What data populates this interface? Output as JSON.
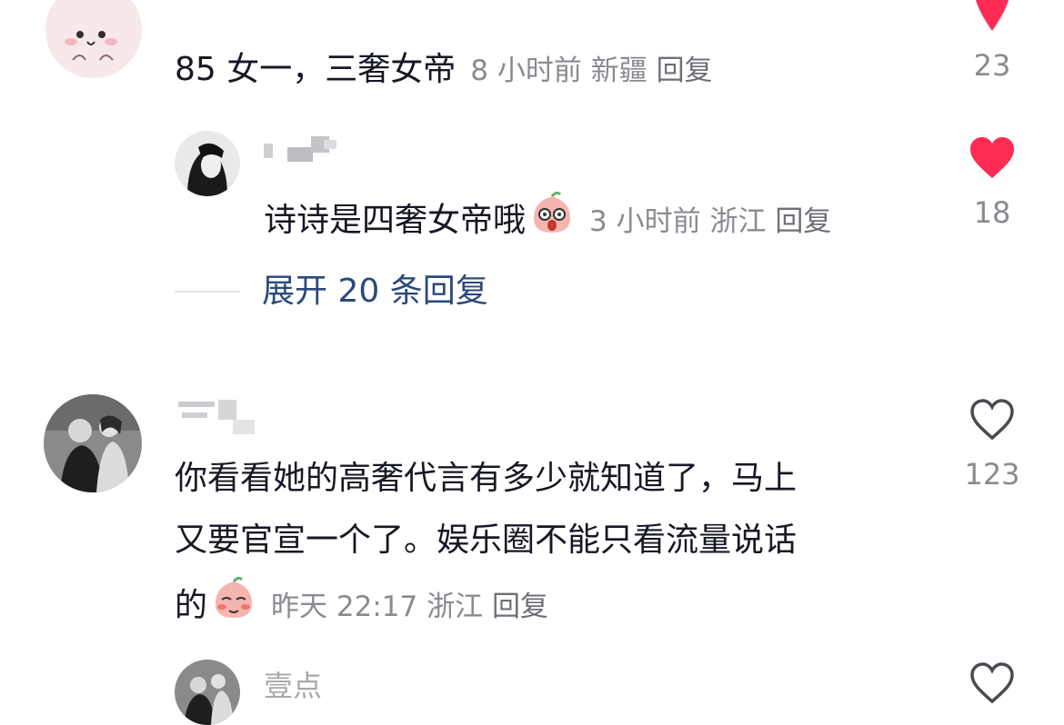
{
  "comments": [
    {
      "text": "85 女一，三奢女帝",
      "time": "8 小时前",
      "location": "新疆",
      "reply_label": "回复",
      "likes": "23",
      "liked": true,
      "reply": {
        "text": "诗诗是四奢女帝哦",
        "emoji": "shock-peach-emoji",
        "time": "3 小时前",
        "location": "浙江",
        "reply_label": "回复",
        "likes": "18",
        "liked": true
      },
      "expand_label": "展开 20 条回复"
    },
    {
      "text_line1": "你看看她的高奢代言有多少就知道了，马上",
      "text_line2": "又要官宣一个了。娱乐圈不能只看流量说话",
      "text_line3": "的",
      "emoji": "shy-peach-emoji",
      "time": "昨天 22:17",
      "location": "浙江",
      "reply_label": "回复",
      "likes": "123",
      "liked": false
    },
    {
      "username": "壹点",
      "liked": false
    }
  ],
  "colors": {
    "heart_active": "#fe2c55",
    "text_primary": "#161823",
    "text_secondary": "#8a8b91",
    "link": "#2a4a7a"
  }
}
